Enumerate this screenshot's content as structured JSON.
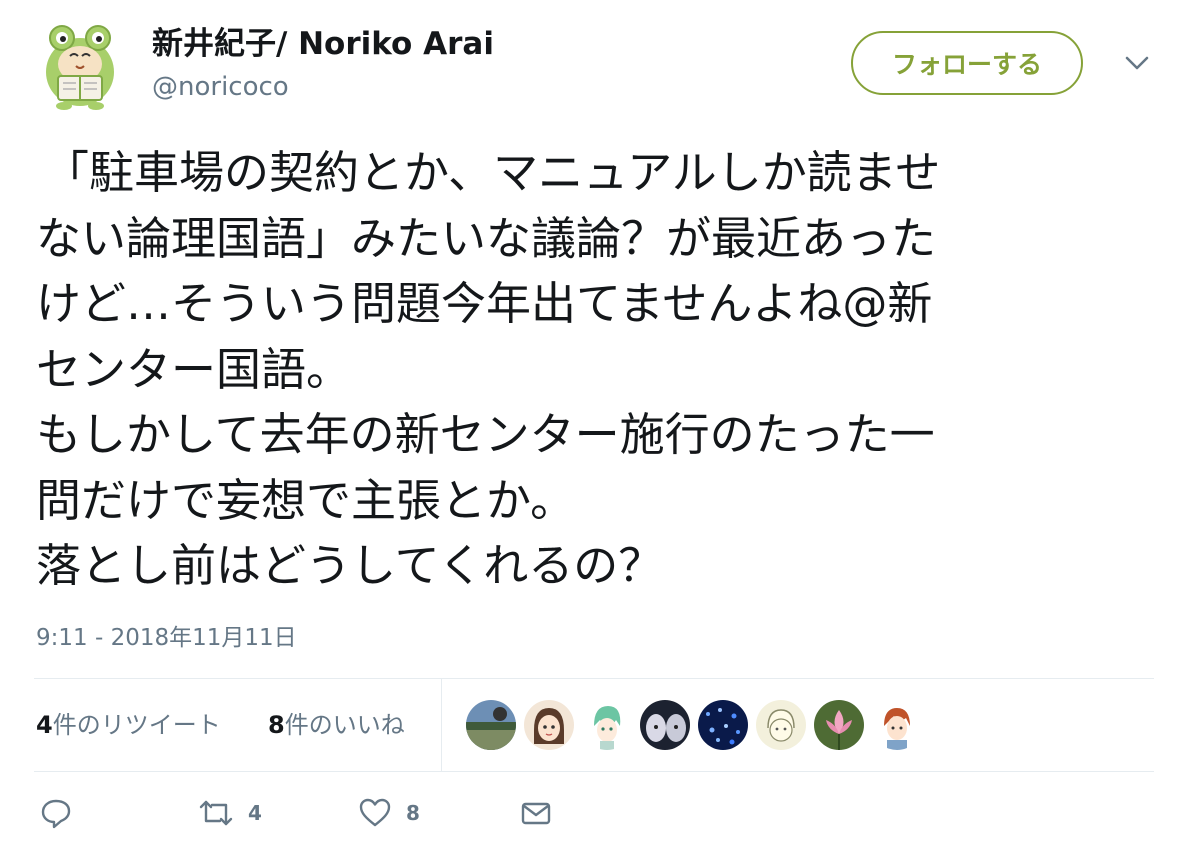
{
  "author": {
    "display_name": "新井紀子/ Noriko Arai",
    "handle": "@noricoco",
    "avatar_icon": "frog-hood-cat-reading-avatar"
  },
  "follow_button": {
    "label": "フォローする",
    "color": "#86a238"
  },
  "more_menu_icon": "chevron-down-icon",
  "tweet": {
    "lines": [
      "「駐車場の契約とか、マニュアルしか読ませ",
      "ない論理国語」みたいな議論？が最近あった",
      "けど…そういう問題今年出てませんよね@新",
      "センター国語。",
      "もしかして去年の新センター施行のたった一",
      "問だけで妄想で主張とか。",
      "落とし前はどうしてくれるの？"
    ],
    "timestamp": "9:11 - 2018年11月11日"
  },
  "stats": {
    "retweets_count": "4",
    "retweets_label": "件のリツイート",
    "likes_count": "8",
    "likes_label": "件のいいね"
  },
  "likers": [
    {
      "name": "liker-avatar-landscape"
    },
    {
      "name": "liker-avatar-anime-girl"
    },
    {
      "name": "liker-avatar-green-hair"
    },
    {
      "name": "liker-avatar-dark-anime"
    },
    {
      "name": "liker-avatar-blue-lights"
    },
    {
      "name": "liker-avatar-sketch"
    },
    {
      "name": "liker-avatar-lotus"
    },
    {
      "name": "liker-avatar-red-hair"
    }
  ],
  "actions": {
    "reply_icon": "reply-icon",
    "retweet_icon": "retweet-icon",
    "retweet_count": "4",
    "like_icon": "heart-icon",
    "like_count": "8",
    "dm_icon": "envelope-icon"
  },
  "colors": {
    "text": "#14171a",
    "secondary": "#657786",
    "divider": "#e6ecf0",
    "accent": "#86a238"
  }
}
